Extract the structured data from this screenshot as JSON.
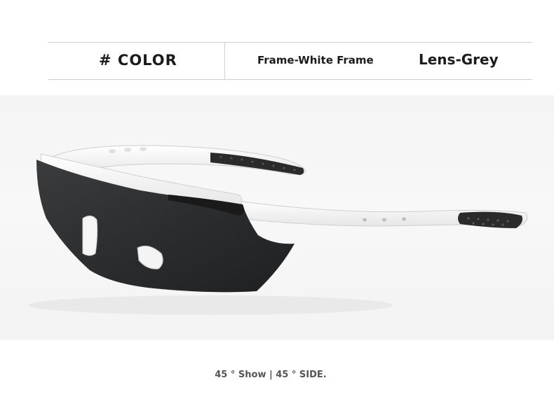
{
  "header": {
    "title": "# COLOR",
    "frame": "Frame-White Frame",
    "lens": "Lens-Grey"
  },
  "product": {
    "frame_color": "#ffffff",
    "lens_color": "#2e3133",
    "icon": "sport-sunglasses"
  },
  "caption": "45 ° Show | 45 ° SIDE."
}
